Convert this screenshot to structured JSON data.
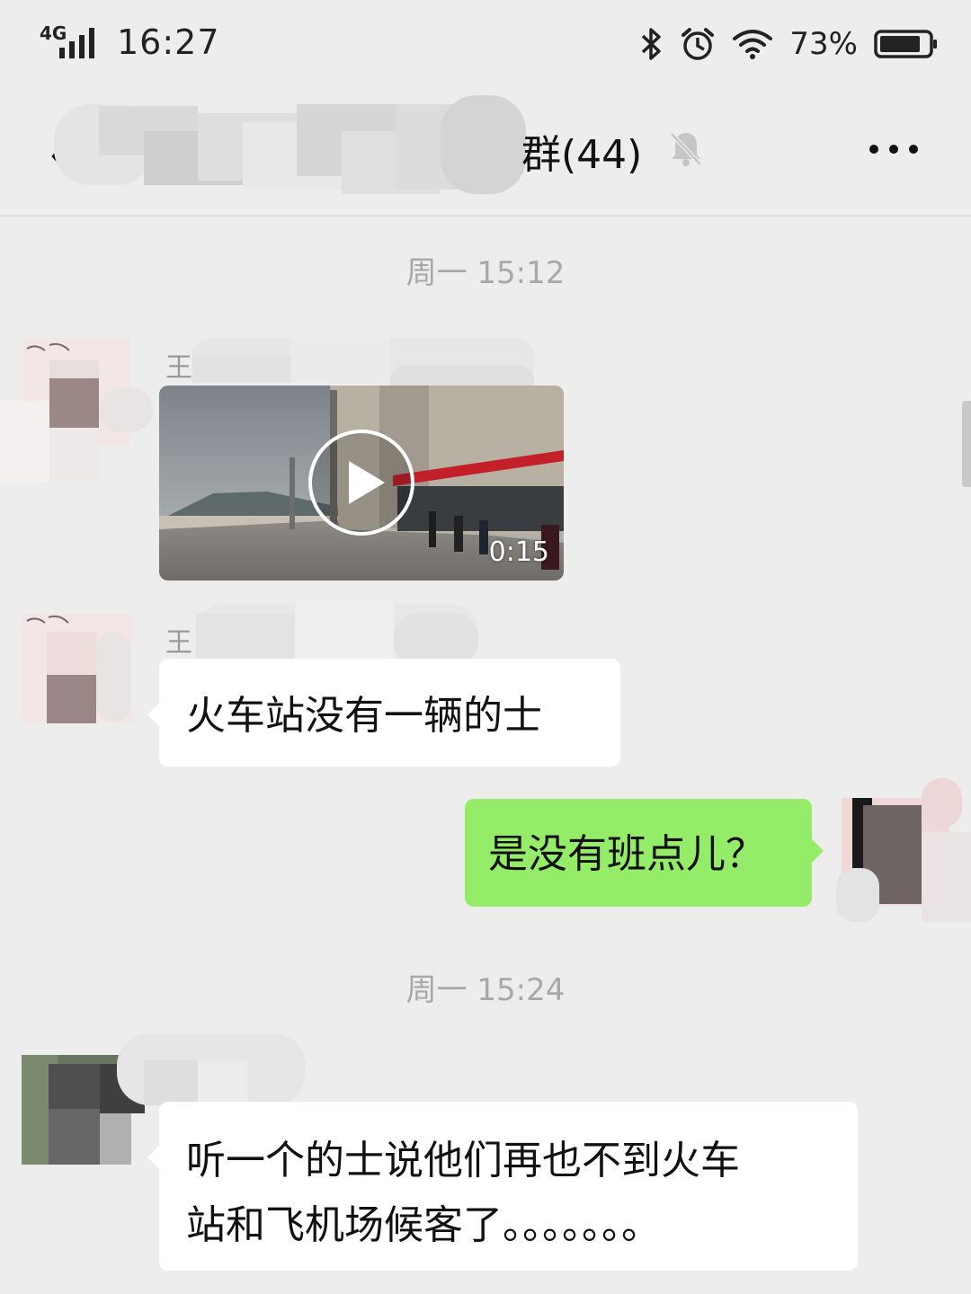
{
  "status_bar": {
    "network": "4G",
    "time": "16:27",
    "battery_percent": "73%",
    "icons": [
      "signal-icon",
      "bluetooth-icon",
      "alarm-icon",
      "wifi-icon",
      "battery-icon"
    ]
  },
  "header": {
    "title": "群(44)",
    "icons": [
      "back-icon",
      "mute-icon",
      "more-icon"
    ]
  },
  "chat": {
    "time_1": "周一 15:12",
    "time_2": "周一 15:24",
    "messages": [
      {
        "sender_initial": "王",
        "type": "video",
        "duration": "0:15"
      },
      {
        "sender_initial": "王",
        "type": "text",
        "text": "火车站没有一辆的士"
      },
      {
        "sender_initial": "",
        "type": "text",
        "outgoing": true,
        "text": "是没有班点儿？"
      },
      {
        "sender_initial": "",
        "type": "text",
        "line1": "听一个的士说他们再也不到火车",
        "line2": "站和飞机场候客了。。。。。。。"
      }
    ]
  },
  "colors": {
    "background": "#ededed",
    "outgoing_bubble": "#95ec69",
    "incoming_bubble": "#ffffff",
    "timestamp": "#a8a8a8"
  }
}
